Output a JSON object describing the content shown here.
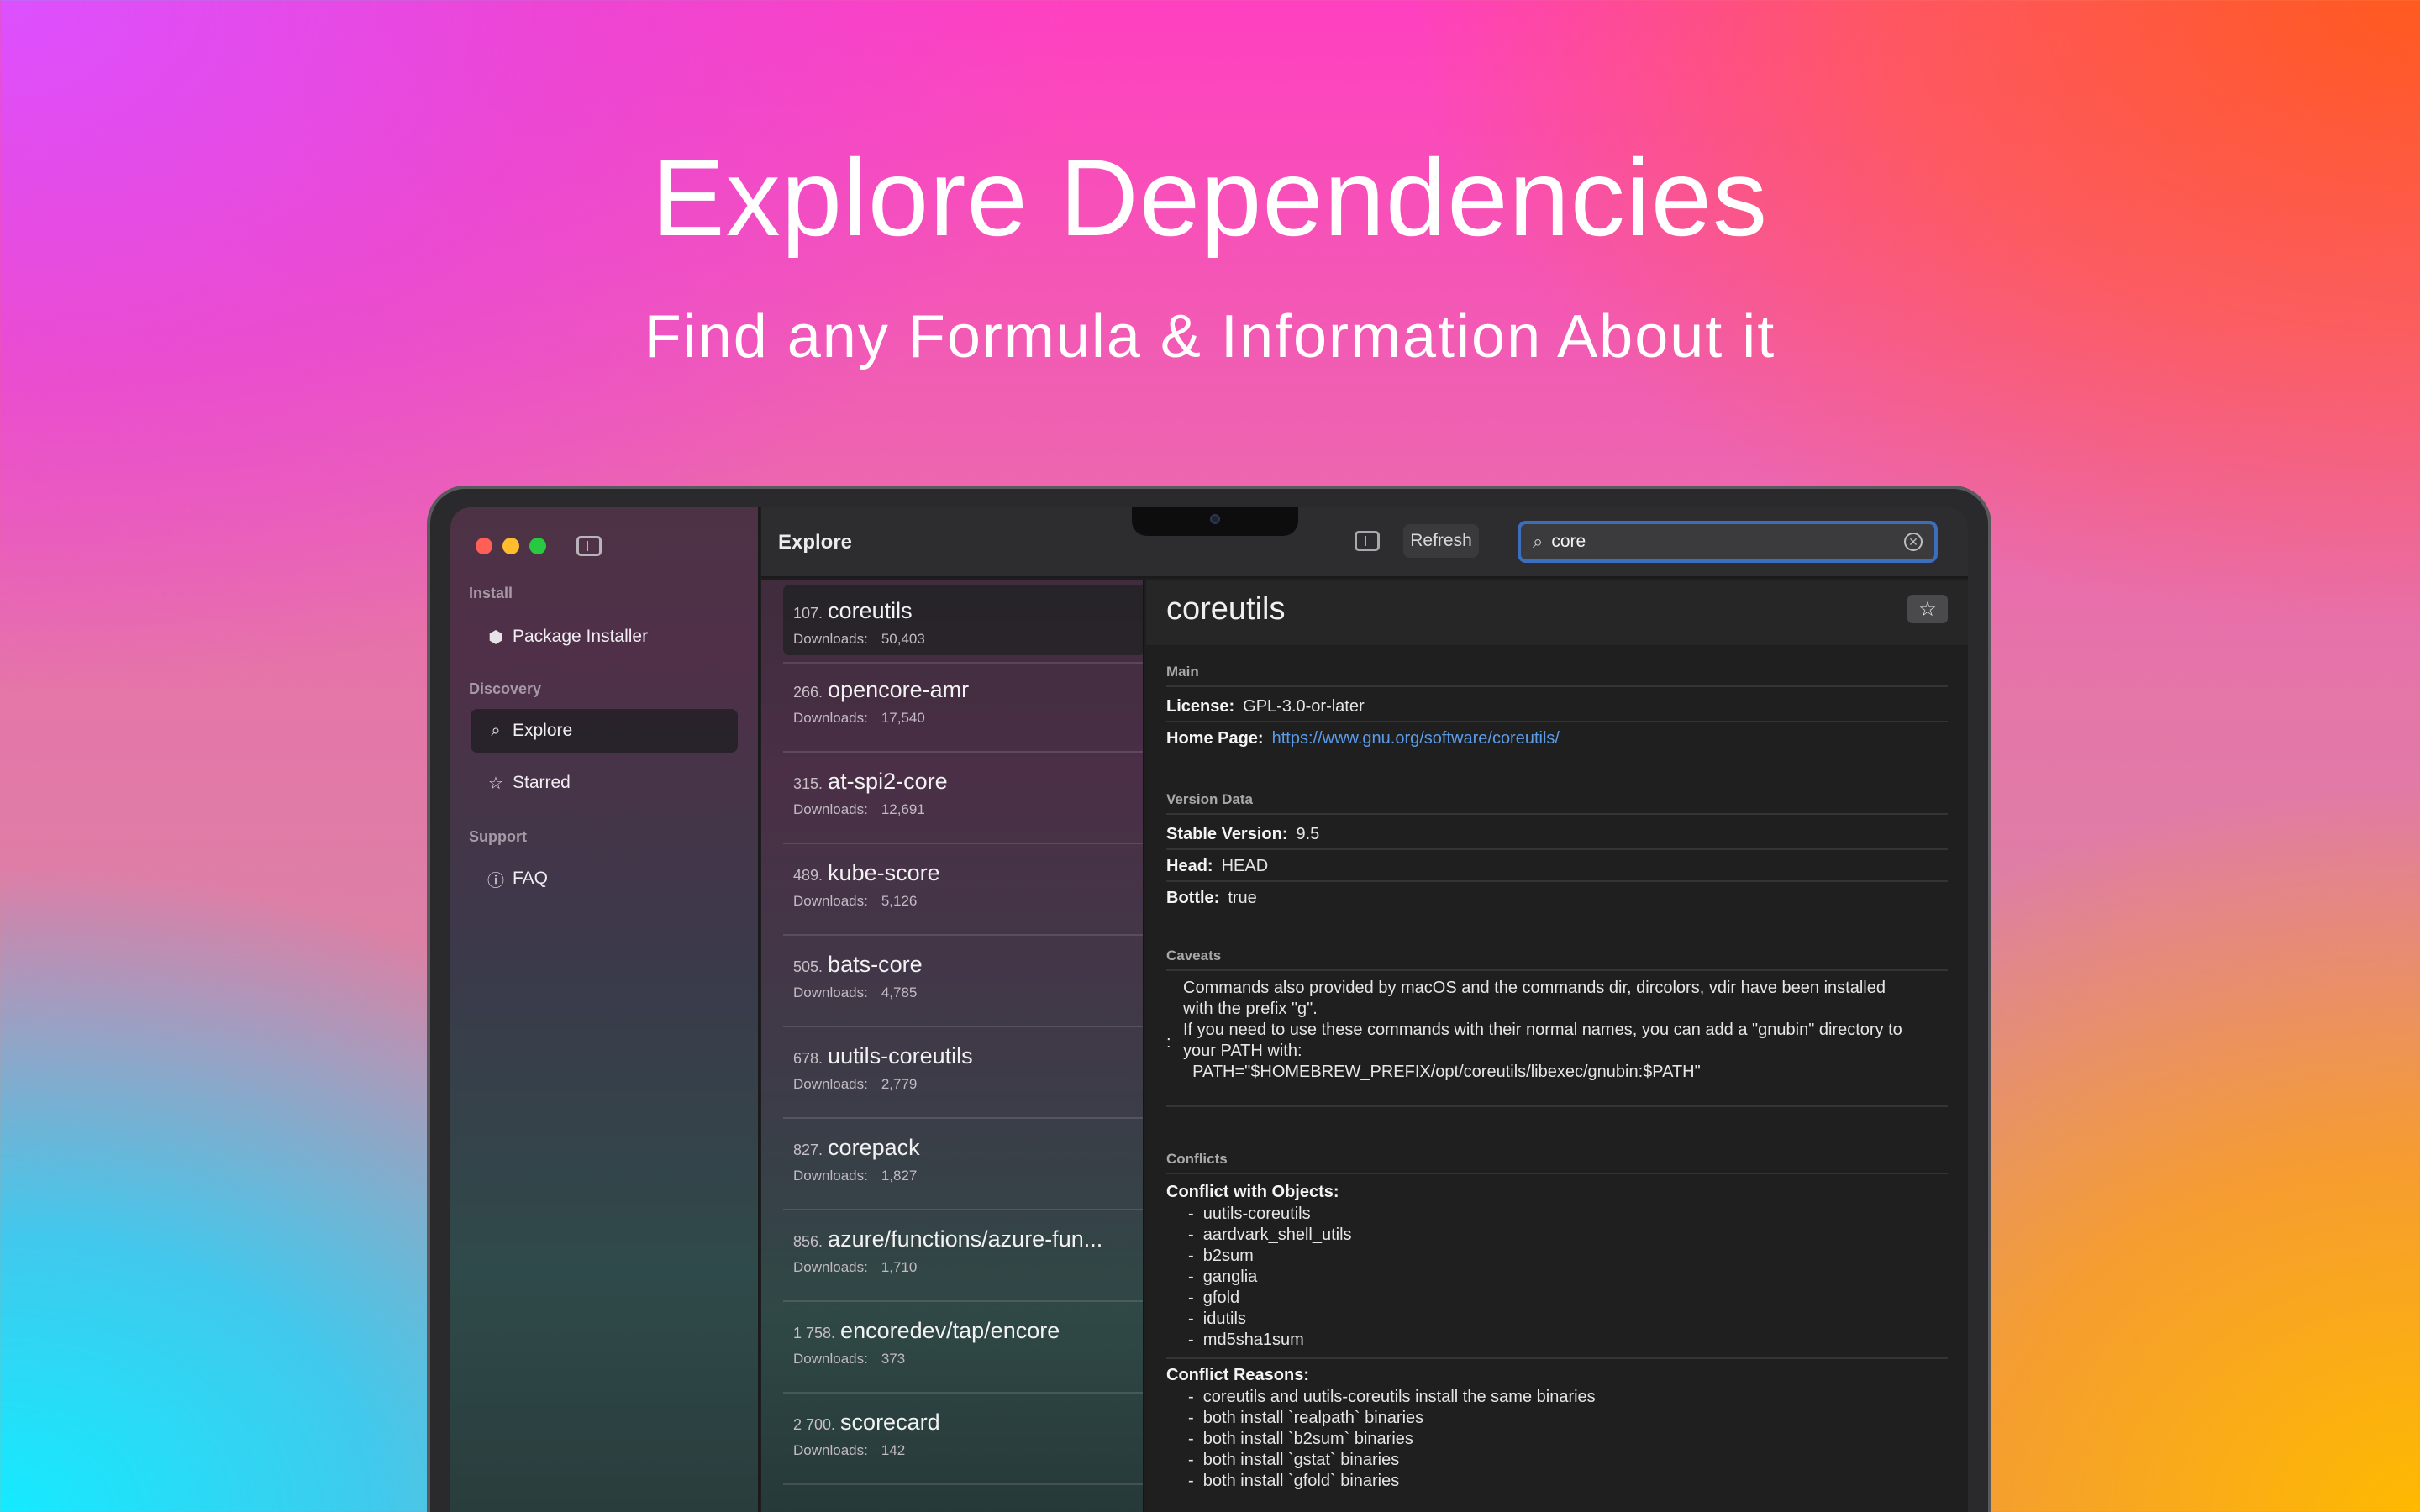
{
  "hero": {
    "title": "Explore Dependencies",
    "subtitle": "Find any Formula & Information About it"
  },
  "sidebar": {
    "sections": [
      {
        "label": "Install",
        "items": [
          {
            "label": "Package Installer",
            "icon": "package-icon"
          }
        ]
      },
      {
        "label": "Discovery",
        "items": [
          {
            "label": "Explore",
            "icon": "search-icon",
            "active": true
          },
          {
            "label": "Starred",
            "icon": "star-icon"
          }
        ]
      },
      {
        "label": "Support",
        "items": [
          {
            "label": "FAQ",
            "icon": "info-icon"
          }
        ]
      }
    ]
  },
  "header": {
    "title": "Explore",
    "refresh_label": "Refresh",
    "search_value": "core"
  },
  "list": [
    {
      "num": "107.",
      "name": "coreutils",
      "downloads_label": "Downloads:",
      "downloads": "50,403",
      "selected": true
    },
    {
      "num": "266.",
      "name": "opencore-amr",
      "downloads_label": "Downloads:",
      "downloads": "17,540"
    },
    {
      "num": "315.",
      "name": "at-spi2-core",
      "downloads_label": "Downloads:",
      "downloads": "12,691"
    },
    {
      "num": "489.",
      "name": "kube-score",
      "downloads_label": "Downloads:",
      "downloads": "5,126"
    },
    {
      "num": "505.",
      "name": "bats-core",
      "downloads_label": "Downloads:",
      "downloads": "4,785"
    },
    {
      "num": "678.",
      "name": "uutils-coreutils",
      "downloads_label": "Downloads:",
      "downloads": "2,779"
    },
    {
      "num": "827.",
      "name": "corepack",
      "downloads_label": "Downloads:",
      "downloads": "1,827"
    },
    {
      "num": "856.",
      "name": "azure/functions/azure-fun...",
      "downloads_label": "Downloads:",
      "downloads": "1,710"
    },
    {
      "num": "1 758.",
      "name": "encoredev/tap/encore",
      "downloads_label": "Downloads:",
      "downloads": "373"
    },
    {
      "num": "2 700.",
      "name": "scorecard",
      "downloads_label": "Downloads:",
      "downloads": "142"
    }
  ],
  "detail": {
    "title": "coreutils",
    "main_label": "Main",
    "license_label": "License:",
    "license": "GPL-3.0-or-later",
    "homepage_label": "Home Page:",
    "homepage": "https://www.gnu.org/software/coreutils/",
    "version_label": "Version Data",
    "stable_label": "Stable Version:",
    "stable": "9.5",
    "head_label": "Head:",
    "head": "HEAD",
    "bottle_label": "Bottle:",
    "bottle": "true",
    "caveats_label": "Caveats",
    "caveats_colon": ":",
    "caveats_lines": [
      "Commands also provided by macOS and the commands dir, dircolors, vdir have been installed",
      "with the prefix \"g\".",
      "If you need to use these commands with their normal names, you can add a \"gnubin\" directory to",
      "your PATH with:",
      "  PATH=\"$HOMEBREW_PREFIX/opt/coreutils/libexec/gnubin:$PATH\""
    ],
    "conflicts_label": "Conflicts",
    "conflict_objects_label": "Conflict with Objects:",
    "conflict_objects": [
      "uutils-coreutils",
      "aardvark_shell_utils",
      "b2sum",
      "ganglia",
      "gfold",
      "idutils",
      "md5sha1sum"
    ],
    "conflict_reasons_label": "Conflict Reasons:",
    "conflict_reasons": [
      "coreutils and uutils-coreutils install the same binaries",
      "both install `realpath` binaries",
      "both install `b2sum` binaries",
      "both install `gstat` binaries",
      "both install `gfold` binaries"
    ]
  }
}
